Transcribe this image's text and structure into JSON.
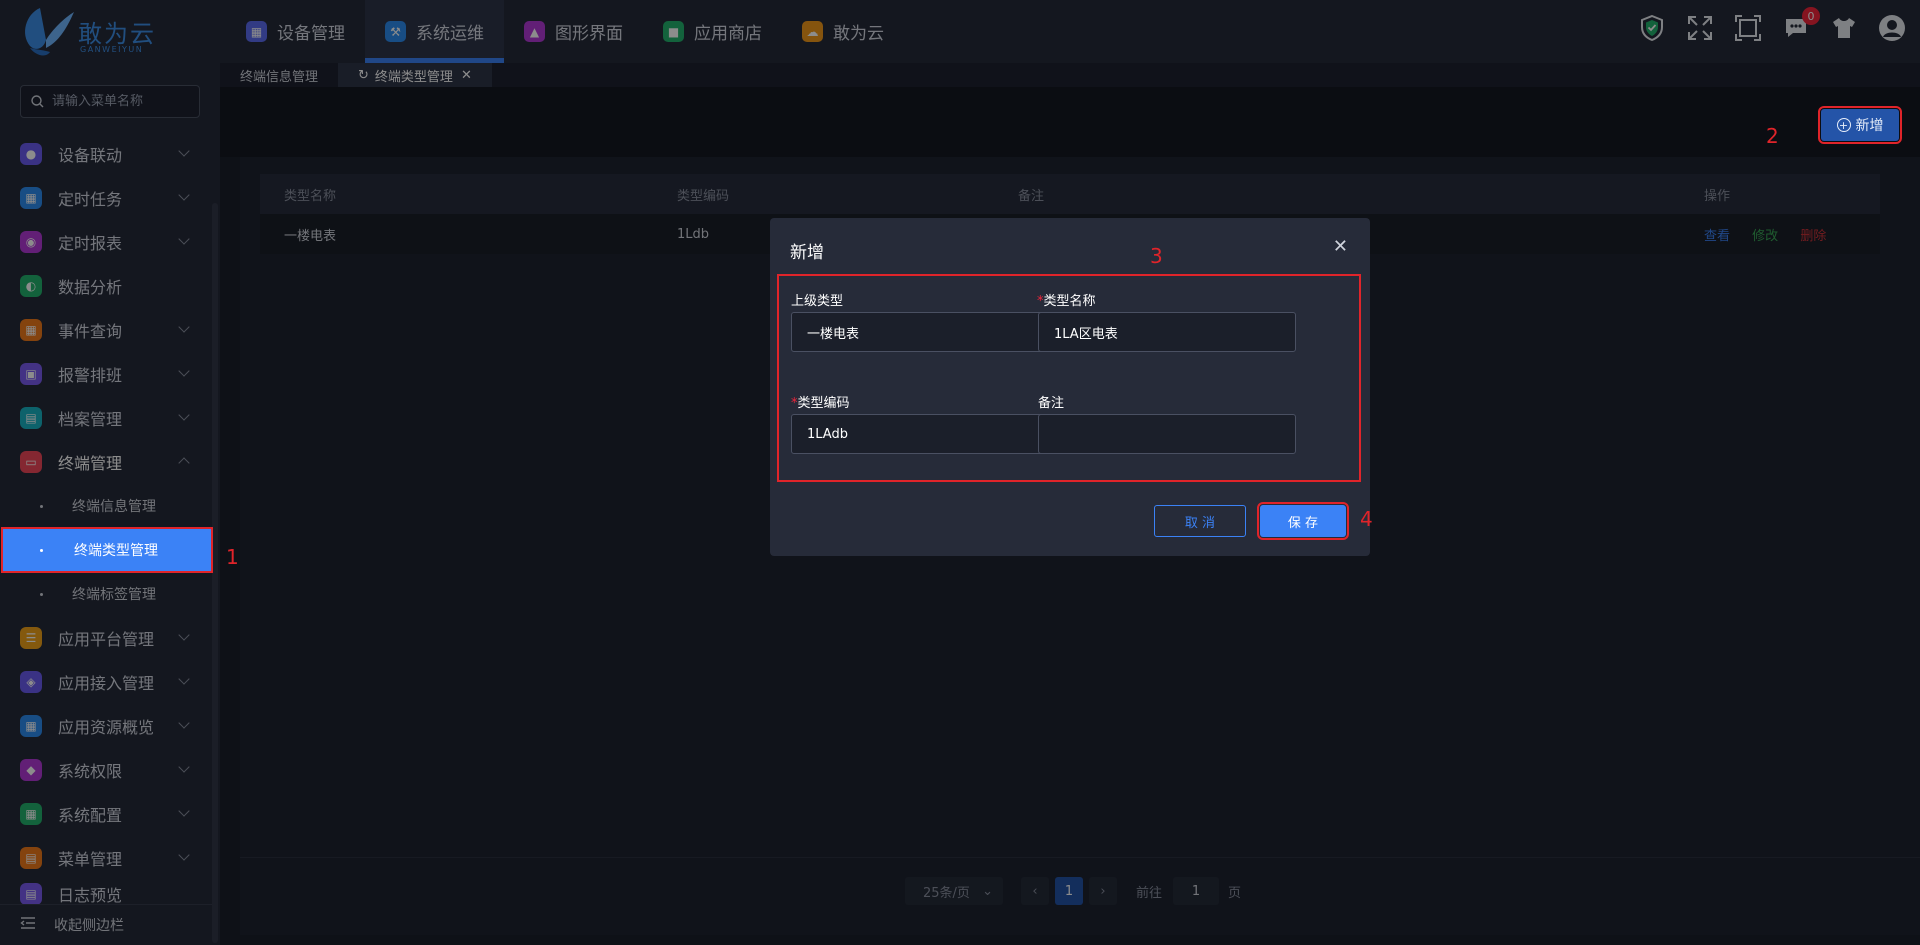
{
  "brand": {
    "name": "敢为云",
    "sub": "GANWEIYUN"
  },
  "topnav": [
    {
      "label": "设备管理",
      "color": "#5b6cf0",
      "icon": "device-icon"
    },
    {
      "label": "系统运维",
      "color": "#2d8cf0",
      "icon": "wrench-icon"
    },
    {
      "label": "图形界面",
      "color": "#b23ad8",
      "icon": "graphic-icon"
    },
    {
      "label": "应用商店",
      "color": "#23b26d",
      "icon": "store-icon"
    },
    {
      "label": "敢为云",
      "color": "#f39a1b",
      "icon": "cloud-icon"
    }
  ],
  "top_right": {
    "message_count": "0"
  },
  "sidebar": {
    "search_placeholder": "请输入菜单名称",
    "items": [
      {
        "label": "设备联动",
        "color": "#6a5cf0"
      },
      {
        "label": "定时任务",
        "color": "#2d8cf0"
      },
      {
        "label": "定时报表",
        "color": "#b23ad8"
      },
      {
        "label": "数据分析",
        "color": "#23b26d"
      },
      {
        "label": "事件查询",
        "color": "#f07a1b"
      },
      {
        "label": "报警排班",
        "color": "#7a5cf0"
      },
      {
        "label": "档案管理",
        "color": "#19b3c4"
      },
      {
        "label": "终端管理",
        "color": "#f0485a"
      }
    ],
    "sub_items": [
      {
        "label": "终端信息管理"
      },
      {
        "label": "终端类型管理"
      },
      {
        "label": "终端标签管理"
      }
    ],
    "items2": [
      {
        "label": "应用平台管理",
        "color": "#f0a21b"
      },
      {
        "label": "应用接入管理",
        "color": "#6a5cf0"
      },
      {
        "label": "应用资源概览",
        "color": "#2d8cf0"
      },
      {
        "label": "系统权限",
        "color": "#b23ad8"
      },
      {
        "label": "系统配置",
        "color": "#23b26d"
      },
      {
        "label": "菜单管理",
        "color": "#f07a1b"
      },
      {
        "label": "日志预览",
        "color": "#7a5cf0"
      }
    ],
    "collapse_label": "收起侧边栏"
  },
  "tabs": [
    {
      "label": "终端信息管理"
    },
    {
      "label": "终端类型管理"
    }
  ],
  "toolbar": {
    "add_label": "新增"
  },
  "table": {
    "headers": [
      "类型名称",
      "类型编码",
      "备注",
      "操作"
    ],
    "rows": [
      {
        "name": "一楼电表",
        "code": "1Ldb",
        "remark": ""
      }
    ],
    "actions": {
      "view": "查看",
      "edit": "修改",
      "delete": "删除"
    }
  },
  "pagination": {
    "page_size": "25条/页",
    "current": "1",
    "goto_label": "前往",
    "goto_value": "1",
    "page_suffix": "页"
  },
  "dialog": {
    "title": "新增",
    "parent_label": "上级类型",
    "parent_value": "一楼电表",
    "name_label": "类型名称",
    "name_value": "1LA区电表",
    "code_label": "类型编码",
    "code_value": "1LAdb",
    "remark_label": "备注",
    "remark_value": "",
    "required_mark": "*",
    "cancel_label": "取 消",
    "save_label": "保 存"
  },
  "annotations": [
    "1",
    "2",
    "3",
    "4"
  ],
  "colors": {
    "accent": "#3b82f6",
    "highlight": "#e0242a",
    "background": "#1b1f2a"
  }
}
